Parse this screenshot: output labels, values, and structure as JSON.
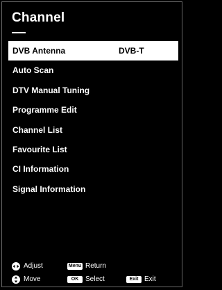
{
  "header": {
    "title": "Channel"
  },
  "menu": {
    "items": [
      {
        "label": "DVB Antenna",
        "value": "DVB-T"
      },
      {
        "label": "Auto Scan"
      },
      {
        "label": "DTV Manual Tuning"
      },
      {
        "label": "Programme Edit"
      },
      {
        "label": "Channel List"
      },
      {
        "label": "Favourite List"
      },
      {
        "label": "CI Information"
      },
      {
        "label": "Signal Information"
      }
    ]
  },
  "legend": {
    "adjust": {
      "icon": "left-right-dpad-icon",
      "label": "Adjust"
    },
    "move": {
      "icon": "up-down-dpad-icon",
      "label": "Move"
    },
    "return": {
      "key": "Menu",
      "label": "Return"
    },
    "select": {
      "key": "OK",
      "label": "Select"
    },
    "exit": {
      "key": "Exit",
      "label": "Exit"
    }
  }
}
